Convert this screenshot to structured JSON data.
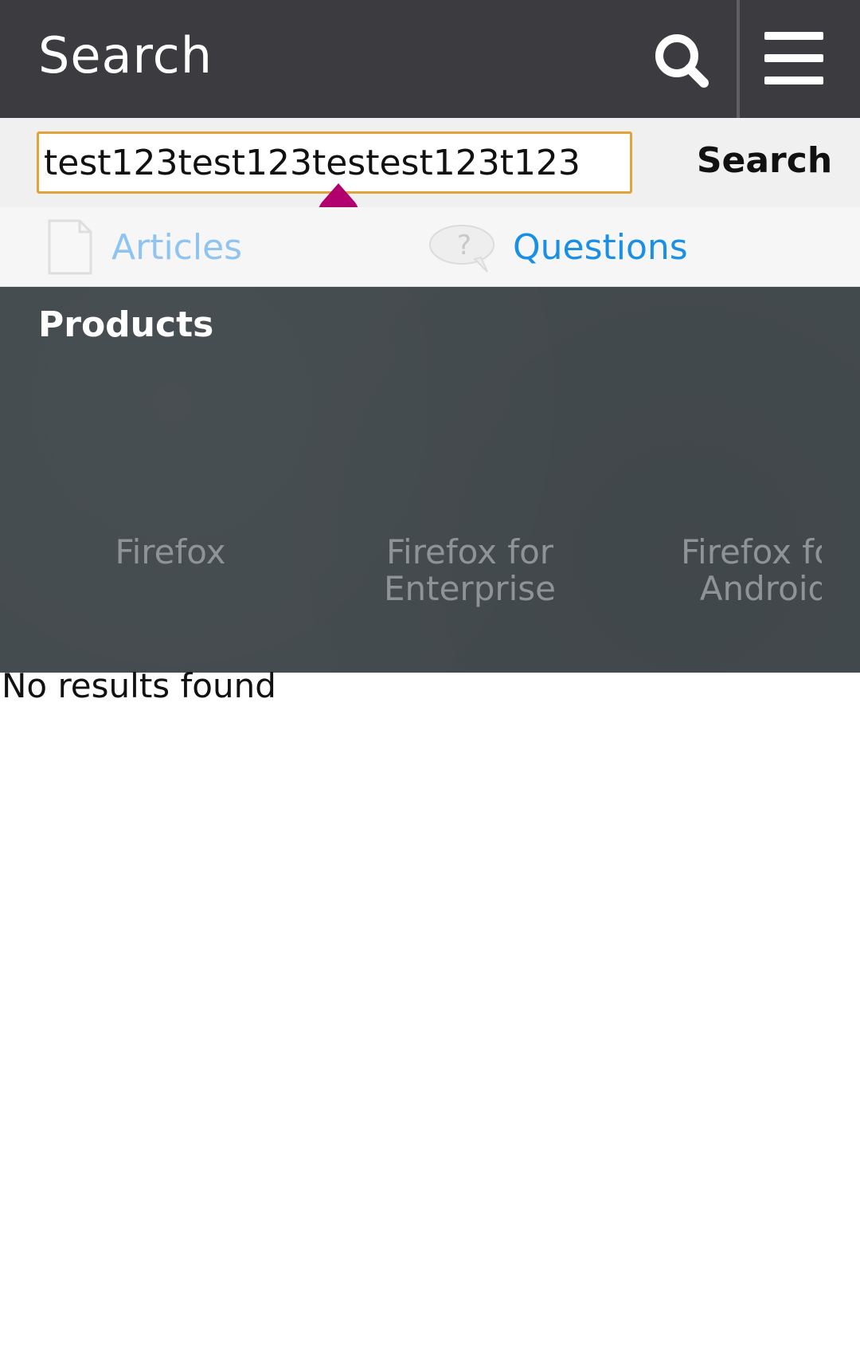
{
  "header": {
    "title": "Search",
    "search_icon": "search-icon",
    "menu_icon": "hamburger-menu-icon"
  },
  "search_form": {
    "query": "test123test123testest123t123",
    "submit_label": "Search"
  },
  "tabs": [
    {
      "label": "Articles",
      "icon": "document-icon"
    },
    {
      "label": "Questions",
      "icon": "question-bubble-icon"
    }
  ],
  "products": {
    "heading": "Products",
    "items": [
      {
        "label": "Firefox"
      },
      {
        "label": "Firefox for Enterprise"
      },
      {
        "label": "Firefox for Android"
      }
    ]
  },
  "results": {
    "message": "No results found"
  },
  "colors": {
    "header_bg": "#3b3b40",
    "input_border": "#e0a43a",
    "cursor_handle": "#b1006e",
    "tab_link": "#1a8fe6",
    "products_bg": "#444b4f"
  }
}
